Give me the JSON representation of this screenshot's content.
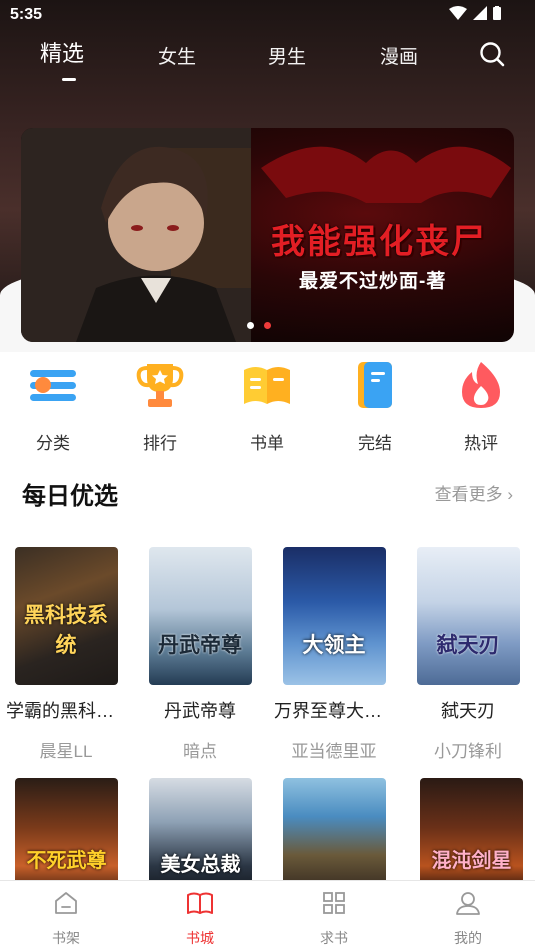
{
  "status": {
    "time": "5:35"
  },
  "tabs": [
    {
      "label": "精选"
    },
    {
      "label": "女生"
    },
    {
      "label": "男生"
    },
    {
      "label": "漫画"
    }
  ],
  "banner": {
    "title": "我能强化丧尸",
    "author": "最爱不过炒面-著"
  },
  "quick": [
    {
      "label": "分类",
      "icon": "category-icon"
    },
    {
      "label": "排行",
      "icon": "trophy-icon"
    },
    {
      "label": "书单",
      "icon": "open-book-icon"
    },
    {
      "label": "完结",
      "icon": "finished-book-icon"
    },
    {
      "label": "热评",
      "icon": "flame-icon"
    }
  ],
  "daily": {
    "title": "每日优选",
    "more": "查看更多 ›",
    "books": [
      {
        "title": "学霸的黑科技系统",
        "author": "晨星LL",
        "cover_text": "黑科技系统"
      },
      {
        "title": "丹武帝尊",
        "author": "暗点",
        "cover_text": "丹武帝尊"
      },
      {
        "title": "万界至尊大领主",
        "author": "亚当德里亚",
        "cover_text": "大领主"
      },
      {
        "title": "弑天刃",
        "author": "小刀锋利",
        "cover_text": "弑天刃"
      }
    ],
    "row2_cover_texts": [
      "不死武尊",
      "美女总裁",
      "",
      "混沌剑星"
    ]
  },
  "nav": [
    {
      "label": "书架",
      "icon": "bookshelf-icon"
    },
    {
      "label": "书城",
      "icon": "bookstore-icon"
    },
    {
      "label": "求书",
      "icon": "request-book-icon"
    },
    {
      "label": "我的",
      "icon": "profile-icon"
    }
  ],
  "colors": {
    "accent": "#e33333",
    "dark_header": "#2b1e1c"
  }
}
